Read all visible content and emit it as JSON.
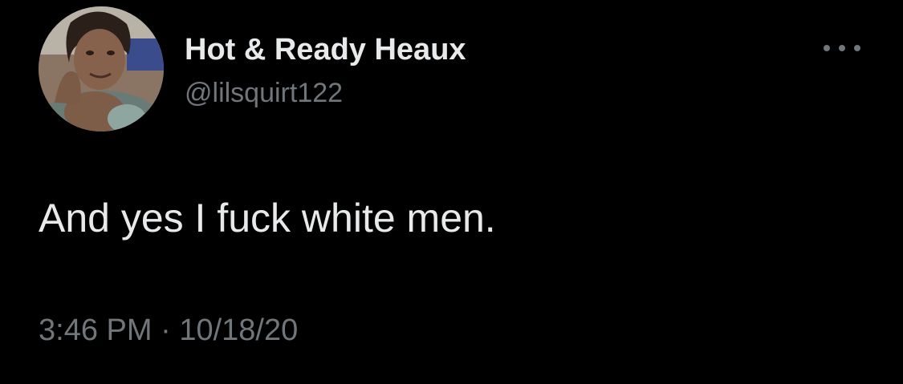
{
  "author": {
    "display_name": "Hot & Ready Heaux",
    "handle": "@lilsquirt122",
    "avatar": "user-avatar-photo"
  },
  "more_menu": {
    "icon": "more-horizontal-icon"
  },
  "tweet": {
    "text": "And yes I fuck white men.",
    "time": "3:46 PM",
    "separator": "·",
    "date": "10/18/20"
  },
  "colors": {
    "background": "#000000",
    "primary_text": "#e7e9ea",
    "secondary_text": "#71767b"
  }
}
